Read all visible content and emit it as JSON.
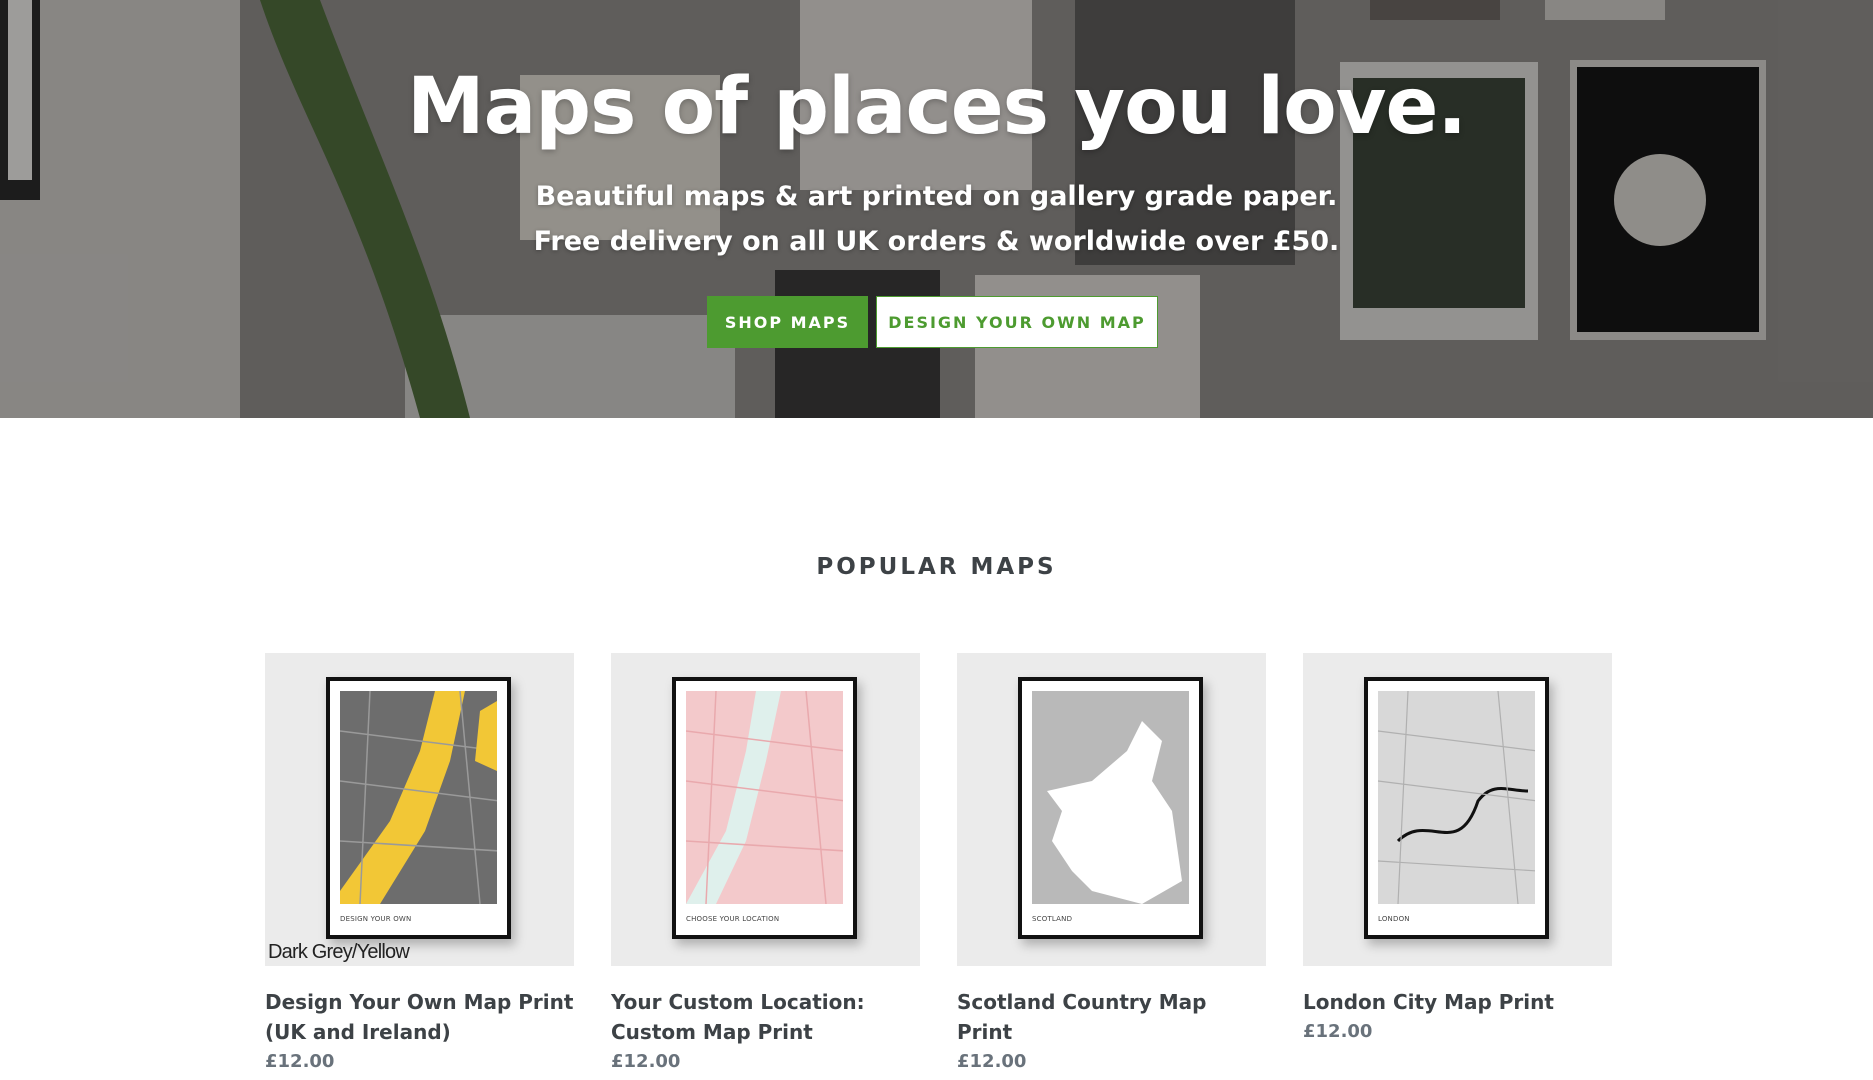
{
  "hero": {
    "title": "Maps of places you love.",
    "subtitle_line1": "Beautiful maps & art printed on gallery grade paper.",
    "subtitle_line2": "Free delivery on all UK orders & worldwide over £50.",
    "primary_button": "SHOP MAPS",
    "secondary_button": "DESIGN YOUR OWN MAP"
  },
  "section": {
    "title": "POPULAR MAPS"
  },
  "products": [
    {
      "title": "Design Your Own Map Print (UK and Ireland)",
      "price": "£12.00",
      "image_caption": "Dark Grey/Yellow",
      "frame_label": "DESIGN YOUR OWN",
      "map_style": "dark-grey-yellow"
    },
    {
      "title": "Your Custom Location: Custom Map Print",
      "price": "£12.00",
      "image_caption": "",
      "frame_label": "CHOOSE YOUR LOCATION",
      "map_style": "pink"
    },
    {
      "title": "Scotland Country Map Print",
      "price": "£12.00",
      "image_caption": "",
      "frame_label": "SCOTLAND",
      "map_style": "grey-white"
    },
    {
      "title": "London City Map Print",
      "price": "£12.00",
      "image_caption": "",
      "frame_label": "LONDON",
      "map_style": "light-grey"
    }
  ],
  "colors": {
    "accent": "#4d9b30",
    "text": "#3d4246",
    "price": "#69727b"
  }
}
